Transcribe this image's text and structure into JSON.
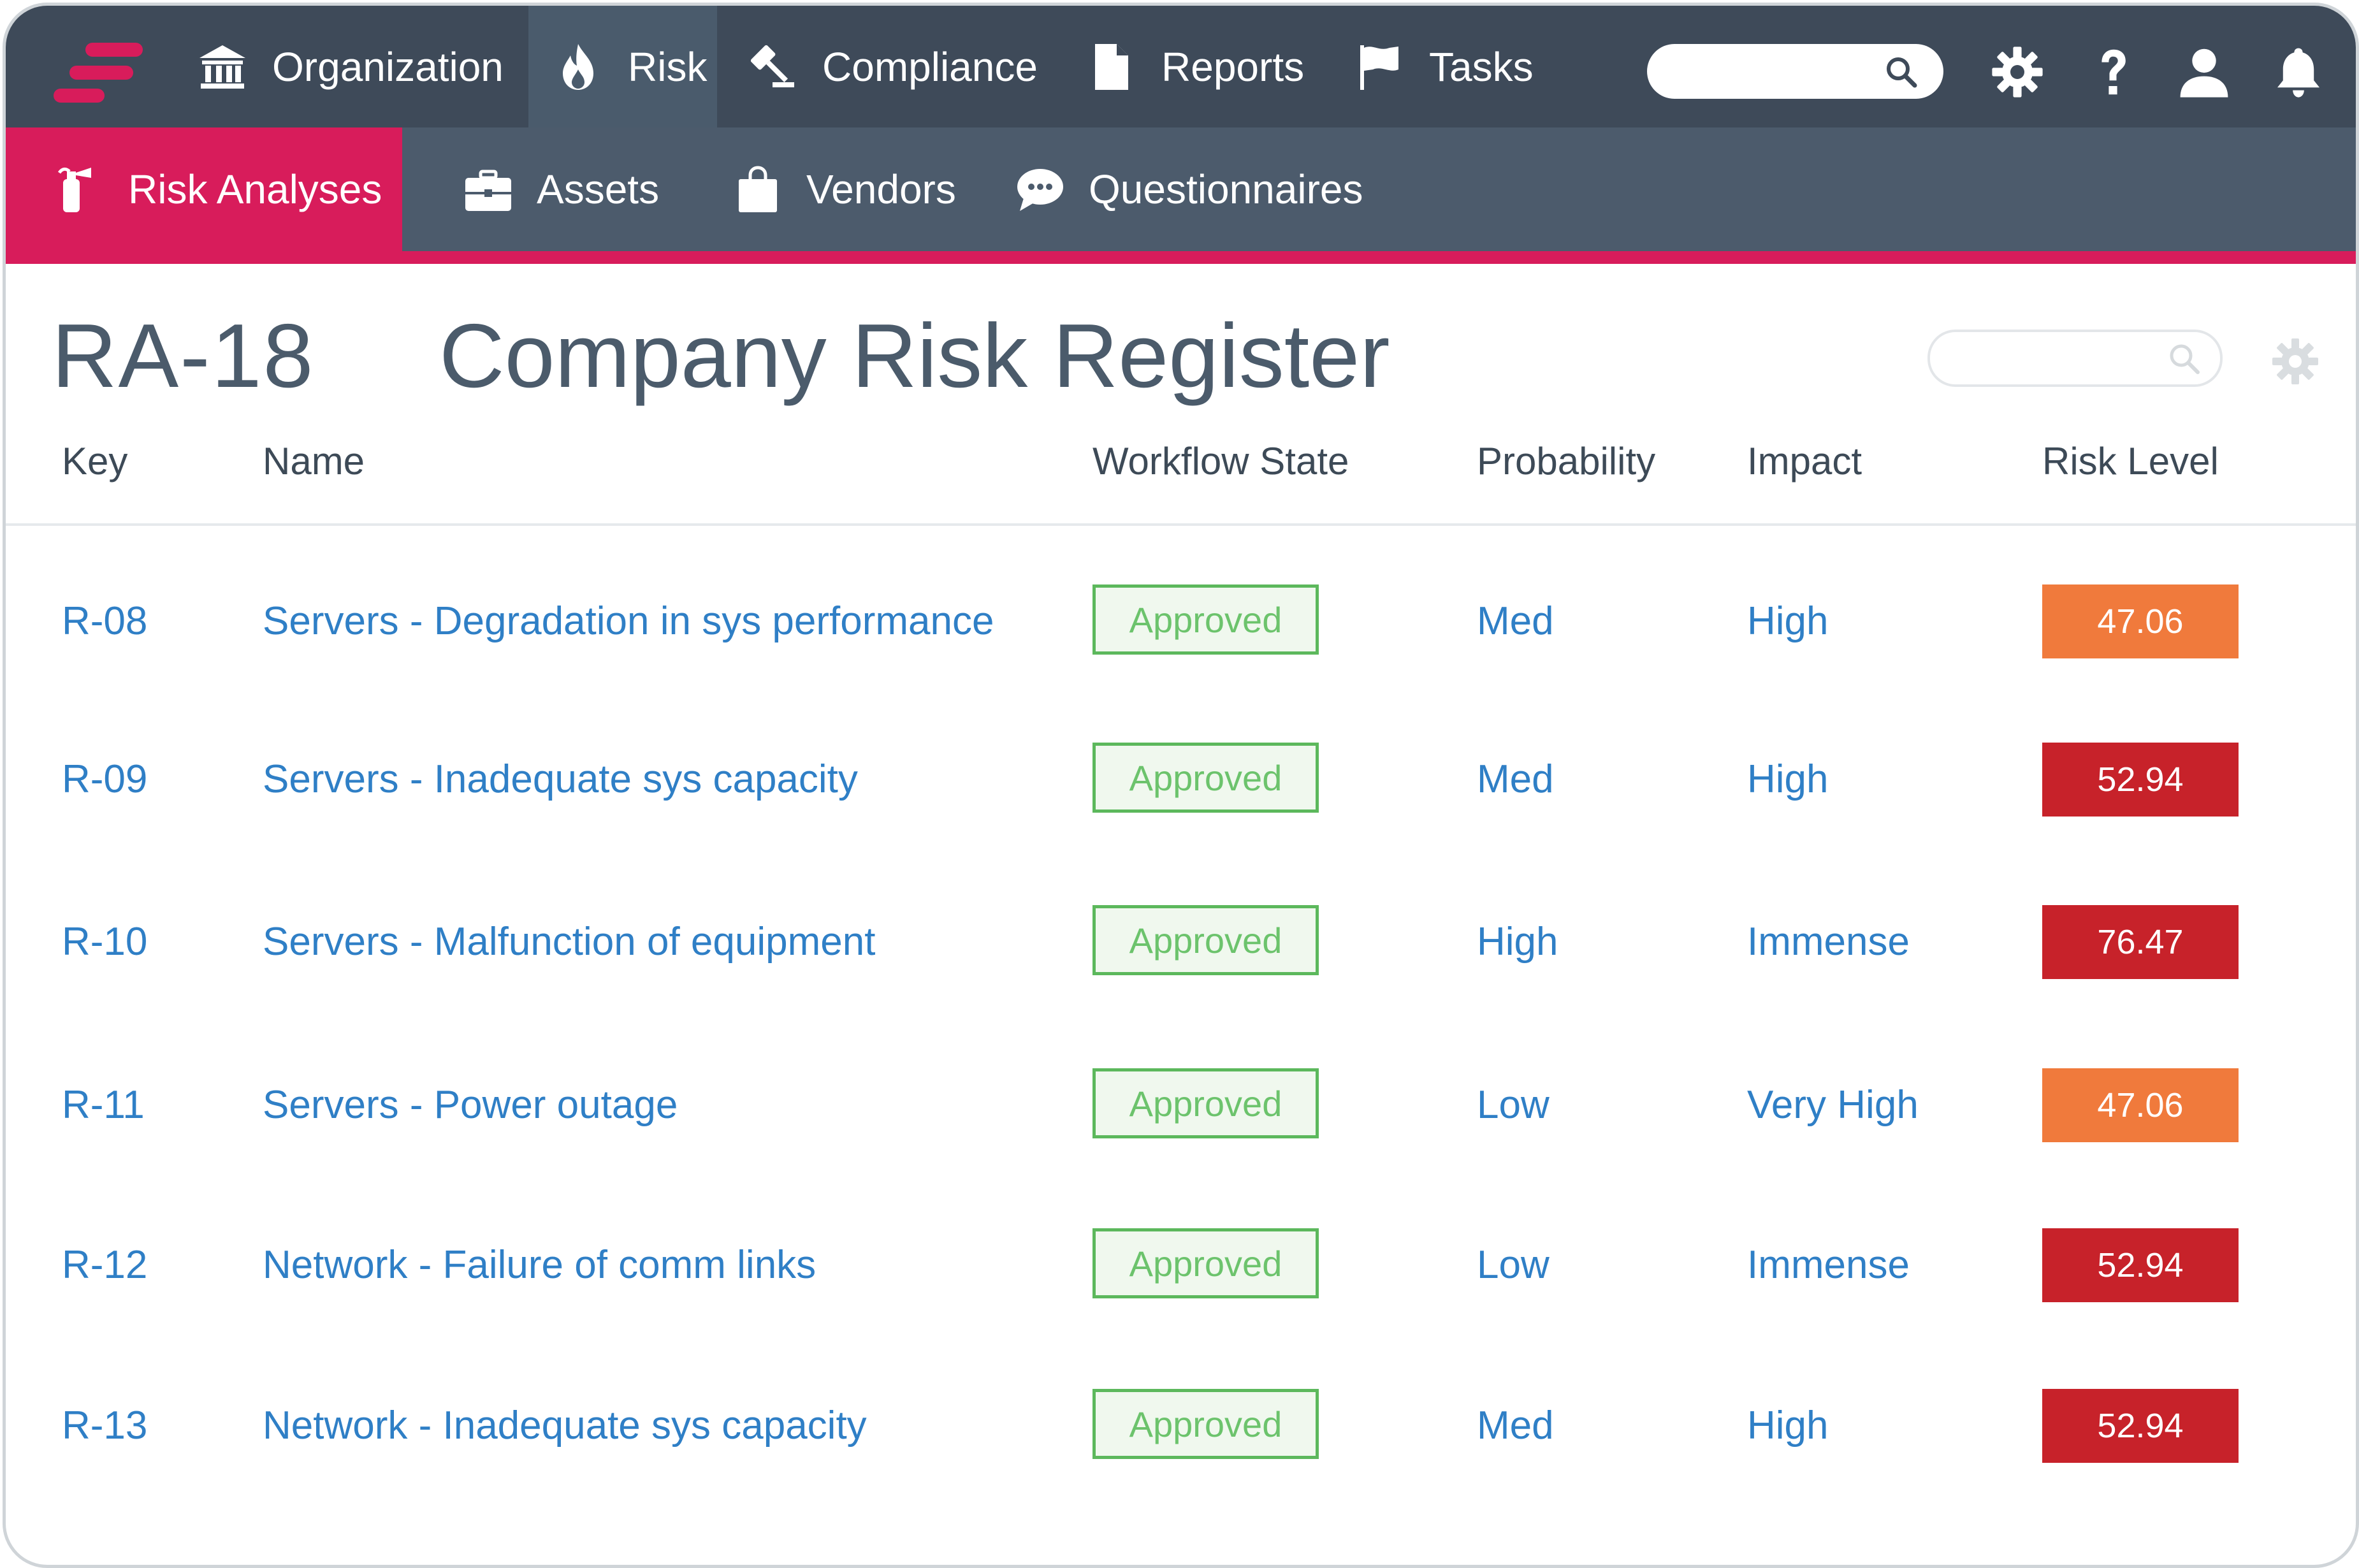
{
  "top_nav": {
    "items": [
      {
        "label": "Organization",
        "icon": "bank-icon"
      },
      {
        "label": "Risk",
        "icon": "fire-icon"
      },
      {
        "label": "Compliance",
        "icon": "gavel-icon"
      },
      {
        "label": "Reports",
        "icon": "document-icon"
      },
      {
        "label": "Tasks",
        "icon": "flag-icon"
      }
    ],
    "search_placeholder": "",
    "right_icons": [
      "gear-icon",
      "help-icon",
      "user-icon",
      "bell-icon"
    ]
  },
  "sub_nav": {
    "items": [
      {
        "label": "Risk Analyses",
        "icon": "fire-extinguisher-icon"
      },
      {
        "label": "Assets",
        "icon": "briefcase-icon"
      },
      {
        "label": "Vendors",
        "icon": "shopping-bag-icon"
      },
      {
        "label": "Questionnaires",
        "icon": "chat-bubble-icon"
      }
    ]
  },
  "page": {
    "key": "RA-18",
    "title": "Company Risk Register",
    "search_placeholder": ""
  },
  "table": {
    "columns": [
      "Key",
      "Name",
      "Workflow State",
      "Probability",
      "Impact",
      "Risk Level"
    ],
    "rows": [
      {
        "key": "R-08",
        "name": "Servers - Degradation in sys performance",
        "state": "Approved",
        "probability": "Med",
        "impact": "High",
        "level": "47.06",
        "level_color": "#f07a3c"
      },
      {
        "key": "R-09",
        "name": "Servers - Inadequate sys capacity",
        "state": "Approved",
        "probability": "Med",
        "impact": "High",
        "level": "52.94",
        "level_color": "#c7222a"
      },
      {
        "key": "R-10",
        "name": "Servers - Malfunction of equipment",
        "state": "Approved",
        "probability": "High",
        "impact": "Immense",
        "level": "76.47",
        "level_color": "#c7222a"
      },
      {
        "key": "R-11",
        "name": "Servers - Power outage",
        "state": "Approved",
        "probability": "Low",
        "impact": "Very High",
        "level": "47.06",
        "level_color": "#f07a3c"
      },
      {
        "key": "R-12",
        "name": "Network - Failure of comm links",
        "state": "Approved",
        "probability": "Low",
        "impact": "Immense",
        "level": "52.94",
        "level_color": "#c7222a"
      },
      {
        "key": "R-13",
        "name": "Network - Inadequate sys capacity",
        "state": "Approved",
        "probability": "Med",
        "impact": "High",
        "level": "52.94",
        "level_color": "#c7222a"
      }
    ]
  },
  "colors": {
    "top_nav_bg": "#3e4a59",
    "sub_nav_bg": "#4c5b6c",
    "accent": "#d81c5b",
    "link": "#2f7fc6",
    "approved_green": "#5cb85c",
    "level_orange": "#f07a3c",
    "level_red": "#c7222a"
  }
}
